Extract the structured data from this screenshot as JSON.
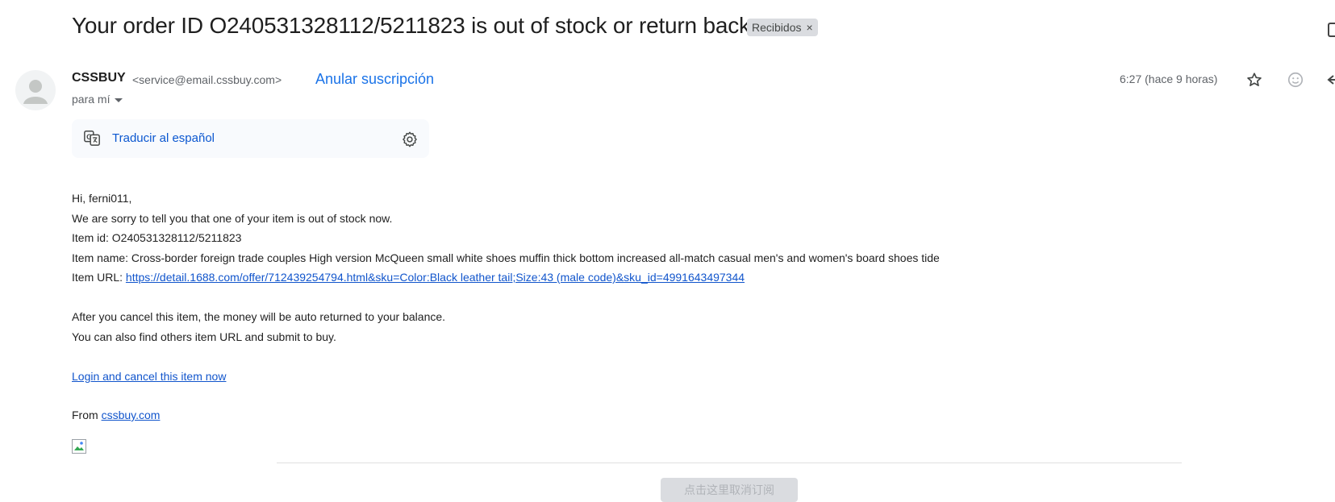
{
  "email": {
    "subject": "Your order ID O240531328112/5211823 is out of stock or return back",
    "label": "Recibidos",
    "label_remove": "×",
    "sender": {
      "name": "CSSBUY",
      "email": "<service@email.cssbuy.com>"
    },
    "unsubscribe": "Anular suscripción",
    "recipient": "para mí",
    "time": "6:27 (hace 9 horas)"
  },
  "translate": {
    "label": "Traducir al español"
  },
  "body": {
    "greeting": "Hi, ferni011,",
    "line1": "We are sorry to tell you that one of your item is out of stock now.",
    "item_id": "Item id: O240531328112/5211823",
    "item_name": "Item name: Cross-border foreign trade couples High version McQueen small white shoes muffin thick bottom increased all-match casual men's and women's board shoes tide",
    "item_url_label": "Item URL: ",
    "item_url": "https://detail.1688.com/offer/712439254794.html&sku=Color:Black leather tail;Size:43 (male code)&sku_id=4991643497344",
    "cancel_note": "After you cancel this item, the money will be auto returned to your balance.",
    "alt_note": "You can also find others item URL and submit to buy.",
    "login_link": "Login and cancel this item now",
    "from_label": "From ",
    "from_link": "cssbuy.com"
  },
  "footer": {
    "button_label": "点击这里取消订阅"
  },
  "icons": {
    "avatar": "person-icon",
    "star": "star-icon",
    "emoji": "emoji-icon",
    "reply": "reply-icon",
    "translate": "translate-icon",
    "settings": "gear-icon"
  },
  "colors": {
    "link": "#1155cc",
    "accent": "#1a73e8",
    "chip": "#dadce0"
  }
}
